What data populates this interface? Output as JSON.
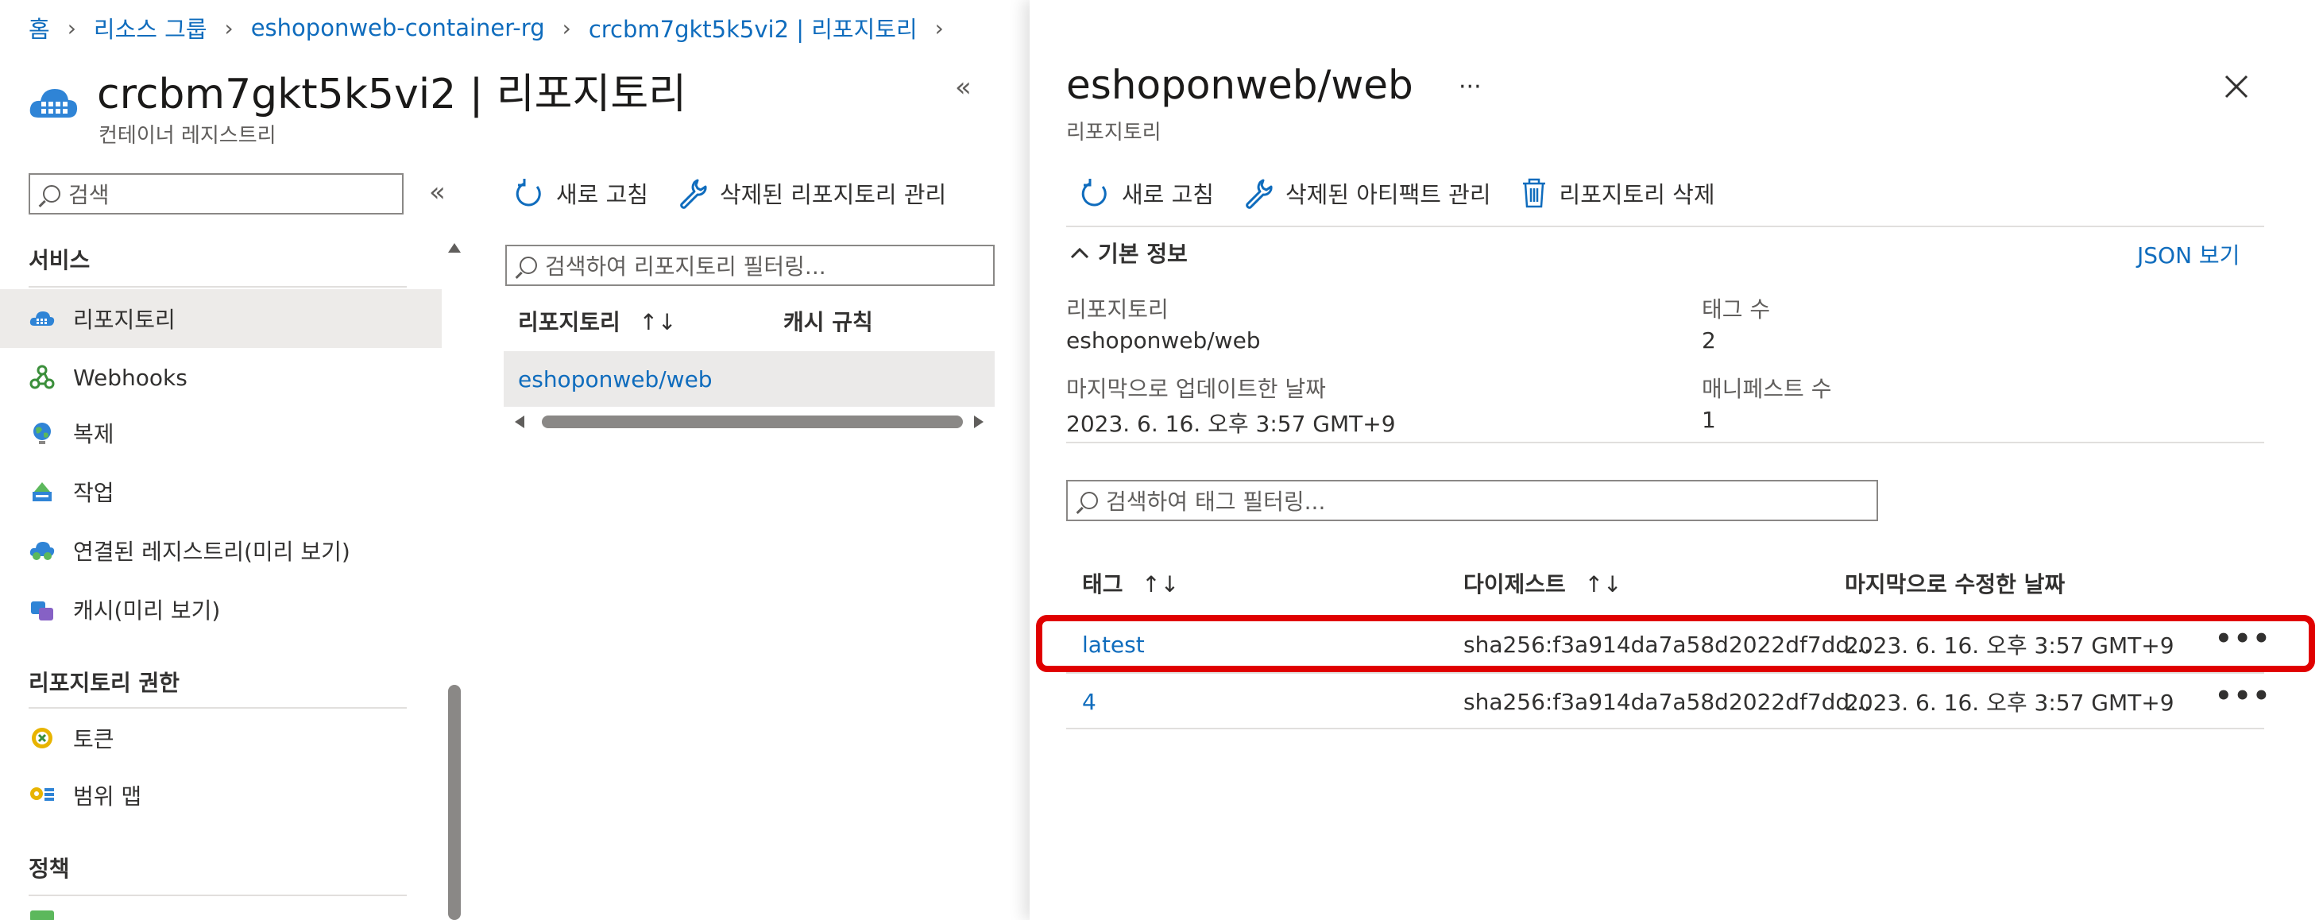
{
  "breadcrumb": [
    "홈",
    "리소스 그룹",
    "eshoponweb-container-rg",
    "crcbm7gkt5k5vi2 | 리포지토리"
  ],
  "header": {
    "title": "crcbm7gkt5k5vi2 | 리포지토리",
    "subtitle": "컨테이너 레지스트리"
  },
  "sidebar": {
    "search_placeholder": "검색",
    "collapse_icon": "double-chevron-left-icon",
    "sections": [
      {
        "title": "서비스"
      },
      {
        "title": "리포지토리 권한"
      },
      {
        "title": "정책"
      }
    ],
    "items": [
      {
        "label": "리포지토리",
        "icon": "container-cloud-icon",
        "selected": true
      },
      {
        "label": "Webhooks",
        "icon": "webhooks-icon"
      },
      {
        "label": "복제",
        "icon": "globe-replication-icon"
      },
      {
        "label": "작업",
        "icon": "tasks-icon"
      },
      {
        "label": "연결된 레지스트리(미리 보기)",
        "icon": "connected-registry-icon"
      },
      {
        "label": "캐시(미리 보기)",
        "icon": "cache-icon"
      },
      {
        "label": "토큰",
        "icon": "token-icon"
      },
      {
        "label": "범위 맵",
        "icon": "scope-map-icon"
      }
    ]
  },
  "middle": {
    "toolbar": {
      "refresh": "새로 고침",
      "manage_deleted": "삭제된 리포지토리 관리"
    },
    "filter_placeholder": "검색하여 리포지토리 필터링...",
    "columns": {
      "repository": "리포지토리",
      "sort": "↑↓",
      "cache_rule": "캐시 규칙"
    },
    "rows": [
      {
        "name": "eshoponweb/web"
      }
    ]
  },
  "panel": {
    "title": "eshoponweb/web",
    "more": "···",
    "subtitle": "리포지토리",
    "toolbar": {
      "refresh": "새로 고침",
      "manage_deleted_artifacts": "삭제된 아티팩트 관리",
      "delete_repo": "리포지토리 삭제"
    },
    "essentials": {
      "toggle": "기본 정보",
      "json_link": "JSON 보기",
      "repository_label": "리포지토리",
      "repository_value": "eshoponweb/web",
      "tag_count_label": "태그 수",
      "tag_count_value": "2",
      "last_updated_label": "마지막으로 업데이트한 날짜",
      "last_updated_value": "2023. 6. 16. 오후 3:57 GMT+9",
      "manifest_count_label": "매니페스트 수",
      "manifest_count_value": "1"
    },
    "tag_filter_placeholder": "검색하여 태그 필터링...",
    "columns": {
      "tag": "태그",
      "digest": "다이제스트",
      "sort": "↑↓",
      "modified": "마지막으로 수정한 날짜"
    },
    "tags": [
      {
        "tag": "latest",
        "digest": "sha256:f3a914da7a58d2022df7dd...",
        "modified": "2023. 6. 16. 오후 3:57 GMT+9",
        "more": "•••",
        "highlighted": true
      },
      {
        "tag": "4",
        "digest": "sha256:f3a914da7a58d2022df7dd...",
        "modified": "2023. 6. 16. 오후 3:57 GMT+9",
        "more": "•••"
      }
    ]
  },
  "colors": {
    "link": "#0f6cbd",
    "highlight": "#e00000",
    "selected_bg": "#edebe9"
  }
}
